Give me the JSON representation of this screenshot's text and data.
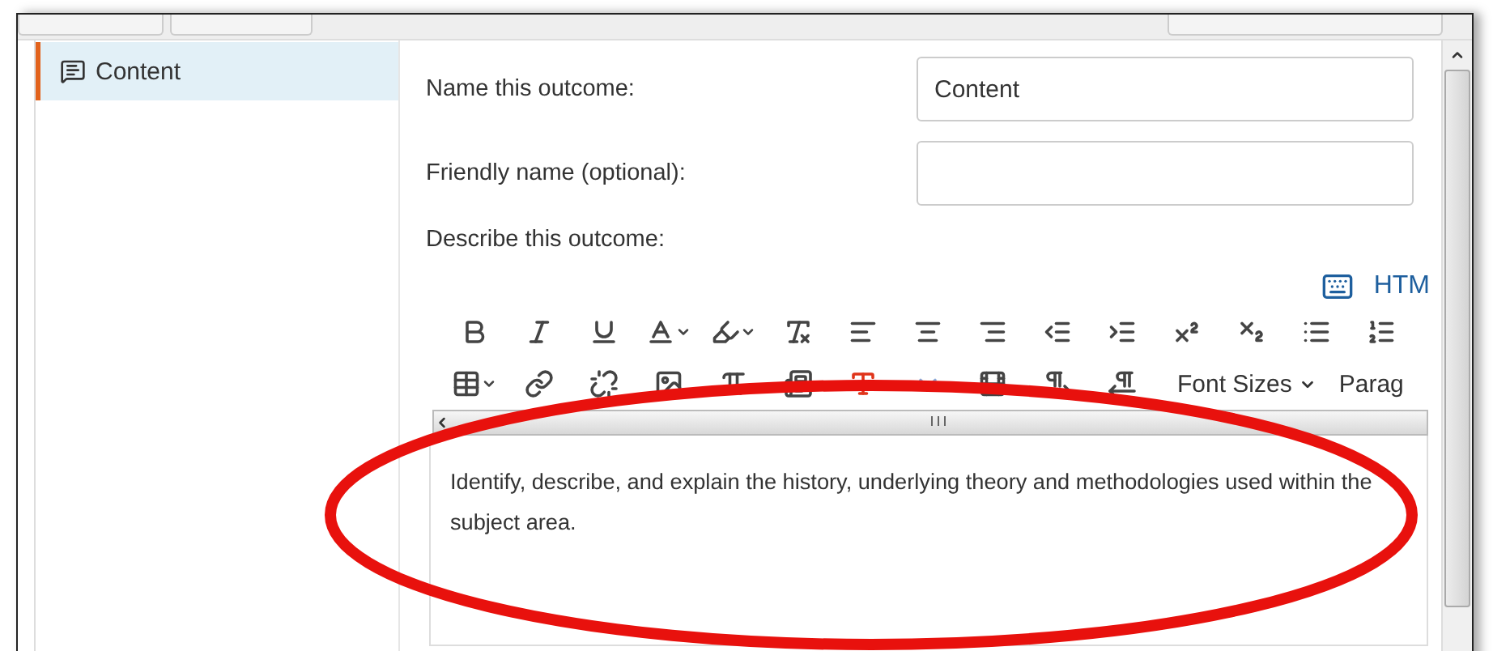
{
  "sidebar": {
    "items": [
      {
        "label": "Content",
        "selected": true
      }
    ]
  },
  "form": {
    "fields": [
      {
        "label": "Name this outcome:",
        "value": "Content"
      },
      {
        "label": "Friendly name (optional):"
      }
    ]
  },
  "description": {
    "label": "Describe this outcome:",
    "html_link": "HTM",
    "dropdowns": [
      {
        "label": "Font Sizes",
        "caret": true
      },
      {
        "label": "Parag",
        "caret": false
      }
    ],
    "text": "Identify, describe, and explain the history, underlying theory and methodologies used within the subject area."
  }
}
